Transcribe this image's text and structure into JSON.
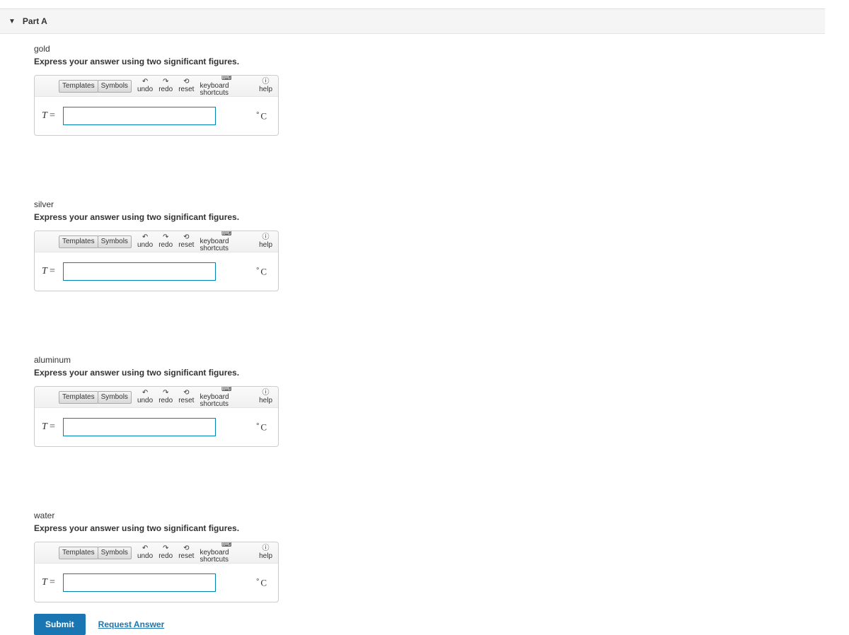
{
  "part": {
    "title": "Part A"
  },
  "toolbar": {
    "templates": "Templates",
    "symbols": "Symbols",
    "undo": "undo",
    "redo": "redo",
    "reset": "reset",
    "keyboard": "keyboard shortcuts",
    "help": "help"
  },
  "common": {
    "instruction": "Express your answer using two significant figures.",
    "var_label": "T",
    "eq": "=",
    "unit": "C",
    "deg": "∘"
  },
  "questions": [
    {
      "label": "gold",
      "value": ""
    },
    {
      "label": "silver",
      "value": ""
    },
    {
      "label": "aluminum",
      "value": ""
    },
    {
      "label": "water",
      "value": ""
    }
  ],
  "actions": {
    "submit": "Submit",
    "request": "Request Answer"
  }
}
